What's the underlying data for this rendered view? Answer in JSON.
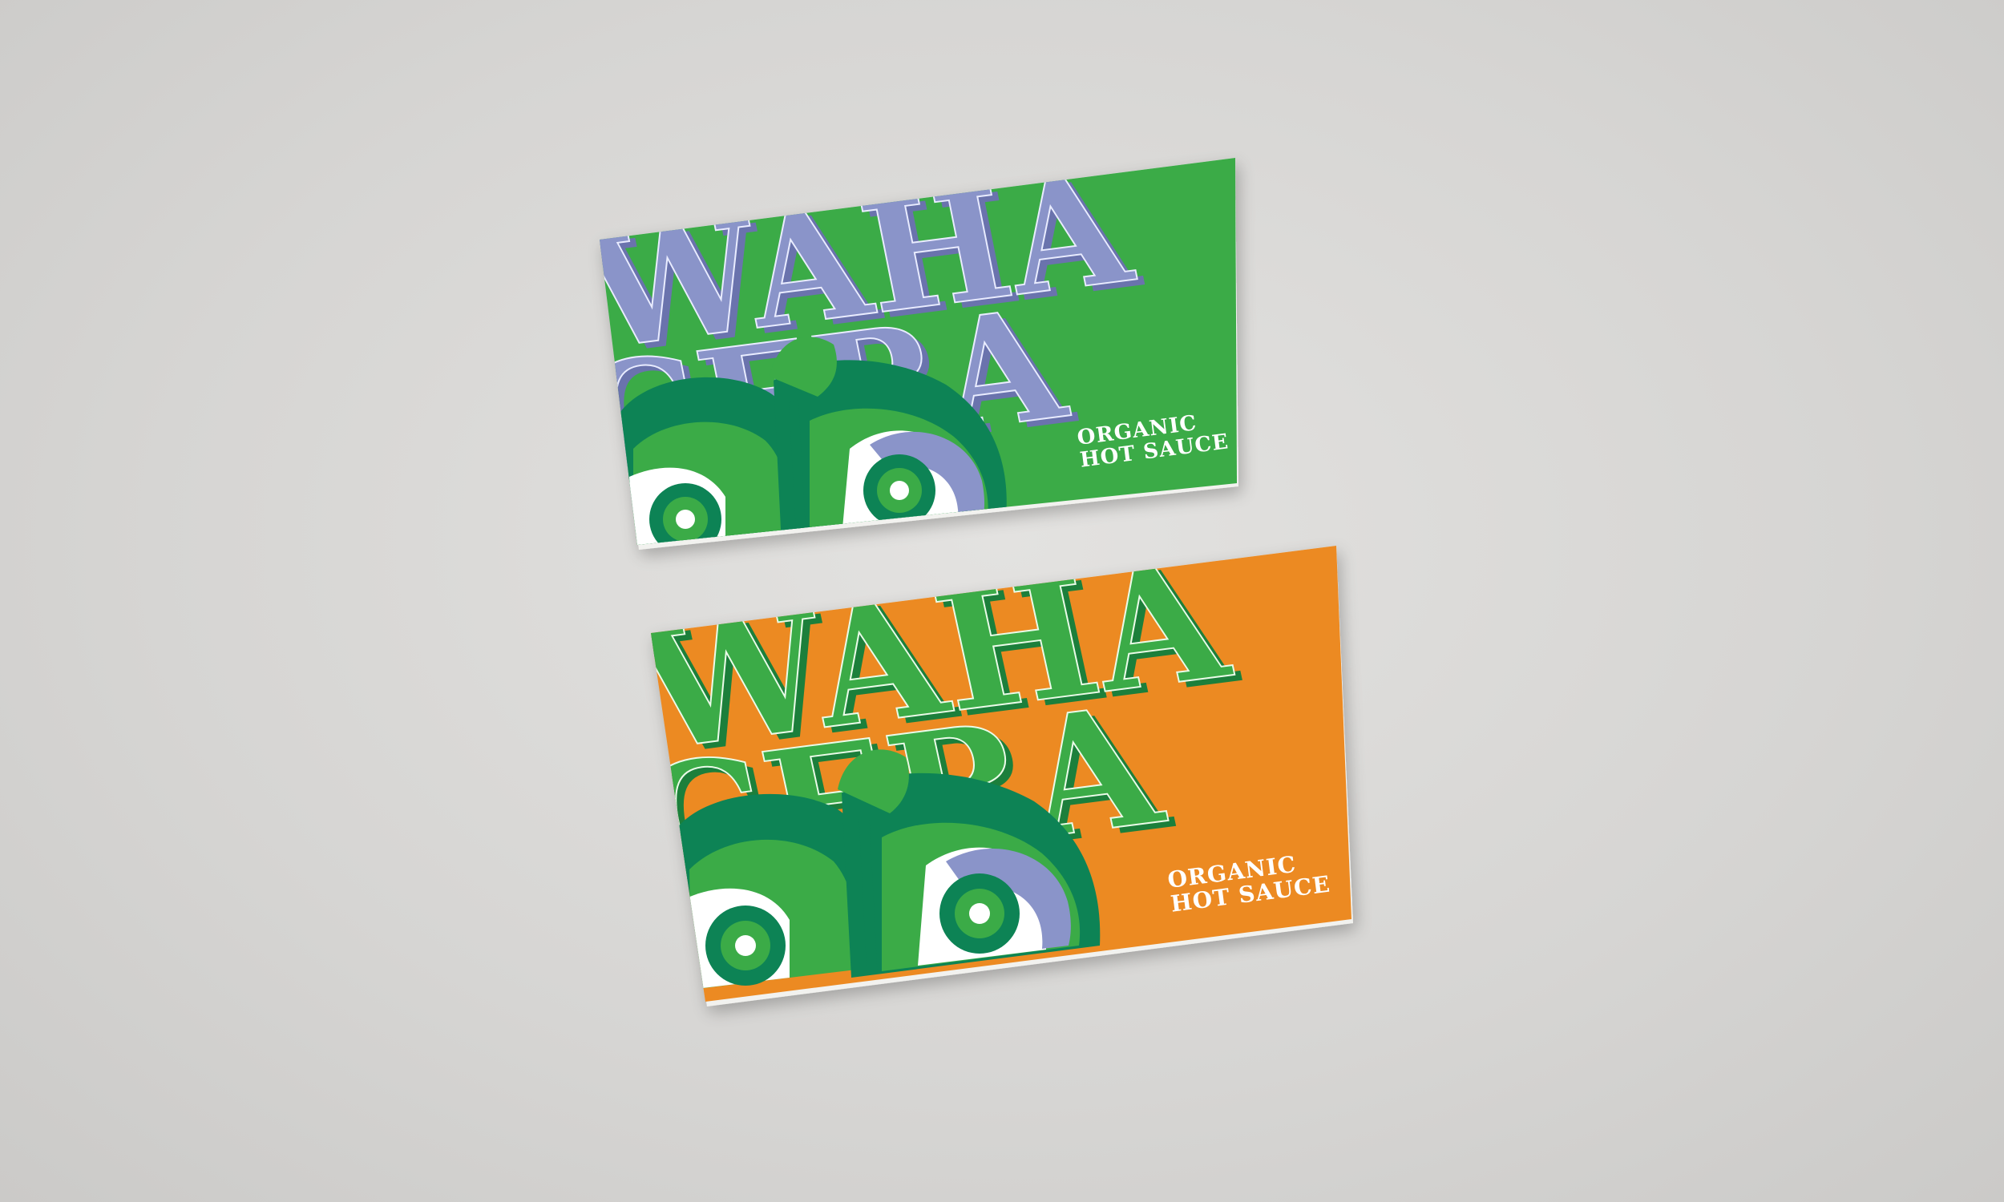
{
  "scene": {
    "background_color": "#d9d8d6"
  },
  "cards": [
    {
      "name": "green-card",
      "background": "#3aab47",
      "letter_fill": "#8a94c9",
      "letter_shadow": "#6a73ad",
      "letter_inline": "#e9ecff",
      "word_line1": "WAHA",
      "word_line2": "CERA",
      "tagline_line1": "ORGANIC",
      "tagline_line2": "HOT SAUCE"
    },
    {
      "name": "orange-card",
      "background": "#ec8a22",
      "letter_fill": "#3aab47",
      "letter_shadow": "#1e7f3a",
      "letter_inline": "#eafbe8",
      "word_line1": "WAHA",
      "word_line2": "CERA",
      "tagline_line1": "ORGANIC",
      "tagline_line2": "HOT SAUCE"
    }
  ],
  "character": {
    "dark_green": "#0c8355",
    "mid_green": "#3aab47",
    "lavender": "#8a94c9",
    "white": "#ffffff"
  }
}
